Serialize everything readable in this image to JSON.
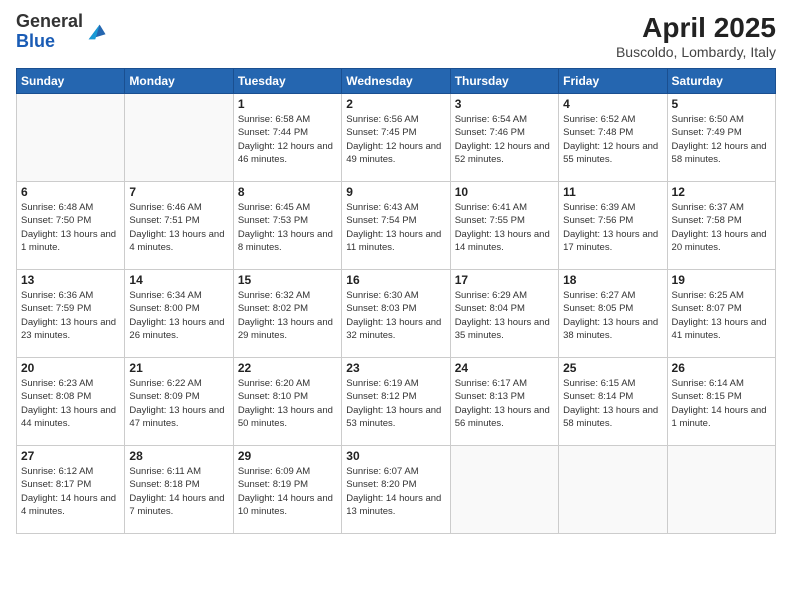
{
  "header": {
    "logo_general": "General",
    "logo_blue": "Blue",
    "title": "April 2025",
    "subtitle": "Buscoldo, Lombardy, Italy"
  },
  "weekdays": [
    "Sunday",
    "Monday",
    "Tuesday",
    "Wednesday",
    "Thursday",
    "Friday",
    "Saturday"
  ],
  "weeks": [
    [
      {
        "day": "",
        "info": ""
      },
      {
        "day": "",
        "info": ""
      },
      {
        "day": "1",
        "info": "Sunrise: 6:58 AM\nSunset: 7:44 PM\nDaylight: 12 hours\nand 46 minutes."
      },
      {
        "day": "2",
        "info": "Sunrise: 6:56 AM\nSunset: 7:45 PM\nDaylight: 12 hours\nand 49 minutes."
      },
      {
        "day": "3",
        "info": "Sunrise: 6:54 AM\nSunset: 7:46 PM\nDaylight: 12 hours\nand 52 minutes."
      },
      {
        "day": "4",
        "info": "Sunrise: 6:52 AM\nSunset: 7:48 PM\nDaylight: 12 hours\nand 55 minutes."
      },
      {
        "day": "5",
        "info": "Sunrise: 6:50 AM\nSunset: 7:49 PM\nDaylight: 12 hours\nand 58 minutes."
      }
    ],
    [
      {
        "day": "6",
        "info": "Sunrise: 6:48 AM\nSunset: 7:50 PM\nDaylight: 13 hours\nand 1 minute."
      },
      {
        "day": "7",
        "info": "Sunrise: 6:46 AM\nSunset: 7:51 PM\nDaylight: 13 hours\nand 4 minutes."
      },
      {
        "day": "8",
        "info": "Sunrise: 6:45 AM\nSunset: 7:53 PM\nDaylight: 13 hours\nand 8 minutes."
      },
      {
        "day": "9",
        "info": "Sunrise: 6:43 AM\nSunset: 7:54 PM\nDaylight: 13 hours\nand 11 minutes."
      },
      {
        "day": "10",
        "info": "Sunrise: 6:41 AM\nSunset: 7:55 PM\nDaylight: 13 hours\nand 14 minutes."
      },
      {
        "day": "11",
        "info": "Sunrise: 6:39 AM\nSunset: 7:56 PM\nDaylight: 13 hours\nand 17 minutes."
      },
      {
        "day": "12",
        "info": "Sunrise: 6:37 AM\nSunset: 7:58 PM\nDaylight: 13 hours\nand 20 minutes."
      }
    ],
    [
      {
        "day": "13",
        "info": "Sunrise: 6:36 AM\nSunset: 7:59 PM\nDaylight: 13 hours\nand 23 minutes."
      },
      {
        "day": "14",
        "info": "Sunrise: 6:34 AM\nSunset: 8:00 PM\nDaylight: 13 hours\nand 26 minutes."
      },
      {
        "day": "15",
        "info": "Sunrise: 6:32 AM\nSunset: 8:02 PM\nDaylight: 13 hours\nand 29 minutes."
      },
      {
        "day": "16",
        "info": "Sunrise: 6:30 AM\nSunset: 8:03 PM\nDaylight: 13 hours\nand 32 minutes."
      },
      {
        "day": "17",
        "info": "Sunrise: 6:29 AM\nSunset: 8:04 PM\nDaylight: 13 hours\nand 35 minutes."
      },
      {
        "day": "18",
        "info": "Sunrise: 6:27 AM\nSunset: 8:05 PM\nDaylight: 13 hours\nand 38 minutes."
      },
      {
        "day": "19",
        "info": "Sunrise: 6:25 AM\nSunset: 8:07 PM\nDaylight: 13 hours\nand 41 minutes."
      }
    ],
    [
      {
        "day": "20",
        "info": "Sunrise: 6:23 AM\nSunset: 8:08 PM\nDaylight: 13 hours\nand 44 minutes."
      },
      {
        "day": "21",
        "info": "Sunrise: 6:22 AM\nSunset: 8:09 PM\nDaylight: 13 hours\nand 47 minutes."
      },
      {
        "day": "22",
        "info": "Sunrise: 6:20 AM\nSunset: 8:10 PM\nDaylight: 13 hours\nand 50 minutes."
      },
      {
        "day": "23",
        "info": "Sunrise: 6:19 AM\nSunset: 8:12 PM\nDaylight: 13 hours\nand 53 minutes."
      },
      {
        "day": "24",
        "info": "Sunrise: 6:17 AM\nSunset: 8:13 PM\nDaylight: 13 hours\nand 56 minutes."
      },
      {
        "day": "25",
        "info": "Sunrise: 6:15 AM\nSunset: 8:14 PM\nDaylight: 13 hours\nand 58 minutes."
      },
      {
        "day": "26",
        "info": "Sunrise: 6:14 AM\nSunset: 8:15 PM\nDaylight: 14 hours\nand 1 minute."
      }
    ],
    [
      {
        "day": "27",
        "info": "Sunrise: 6:12 AM\nSunset: 8:17 PM\nDaylight: 14 hours\nand 4 minutes."
      },
      {
        "day": "28",
        "info": "Sunrise: 6:11 AM\nSunset: 8:18 PM\nDaylight: 14 hours\nand 7 minutes."
      },
      {
        "day": "29",
        "info": "Sunrise: 6:09 AM\nSunset: 8:19 PM\nDaylight: 14 hours\nand 10 minutes."
      },
      {
        "day": "30",
        "info": "Sunrise: 6:07 AM\nSunset: 8:20 PM\nDaylight: 14 hours\nand 13 minutes."
      },
      {
        "day": "",
        "info": ""
      },
      {
        "day": "",
        "info": ""
      },
      {
        "day": "",
        "info": ""
      }
    ]
  ]
}
